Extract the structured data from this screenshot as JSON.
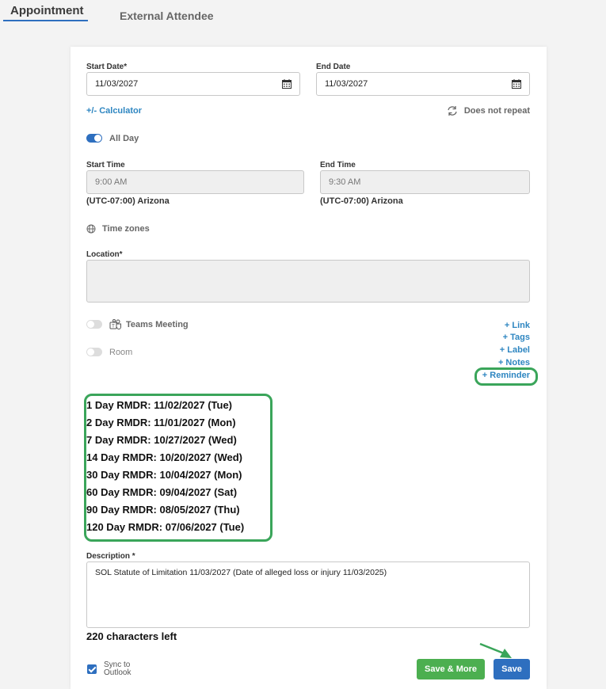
{
  "tabs": [
    {
      "label": "Appointment",
      "active": true
    },
    {
      "label": "External Attendee",
      "active": false
    }
  ],
  "form": {
    "start_date_label": "Start Date*",
    "start_date_value": "11/03/2027",
    "end_date_label": "End Date",
    "end_date_value": "11/03/2027",
    "calculator_link": "+/- Calculator",
    "repeat_label": "Does not repeat",
    "all_day_label": "All Day",
    "start_time_label": "Start Time",
    "start_time_value": "9:00 AM",
    "end_time_label": "End Time",
    "end_time_value": "9:30 AM",
    "start_timezone": "(UTC-07:00) Arizona",
    "end_timezone": "(UTC-07:00) Arizona",
    "time_zones_link": "Time zones",
    "location_label": "Location*",
    "teams_meeting_label": "Teams Meeting",
    "room_label": "Room",
    "links": {
      "link": "+ Link",
      "tags": "+ Tags",
      "label": "+ Label",
      "notes": "+ Notes",
      "reminder": "+ Reminder"
    },
    "reminders": [
      "1 Day RMDR: 11/02/2027 (Tue)",
      "2 Day RMDR: 11/01/2027 (Mon)",
      "7 Day RMDR: 10/27/2027 (Wed)",
      "14 Day RMDR: 10/20/2027 (Wed)",
      "30 Day RMDR: 10/04/2027 (Mon)",
      "60 Day RMDR: 09/04/2027 (Sat)",
      "90 Day RMDR: 08/05/2027 (Thu)",
      "120 Day RMDR: 07/06/2027 (Tue)"
    ],
    "description_label": "Description *",
    "description_value": "SOL Statute of Limitation 11/03/2027 (Date of alleged loss or injury 11/03/2025)",
    "chars_left": "220 characters left",
    "sync_label_line1": "Sync to",
    "sync_label_line2": "Outlook",
    "save_more_button": "Save & More",
    "save_button": "Save"
  },
  "colors": {
    "accent": "#2e6fbf",
    "link": "#2e86c1",
    "highlight": "#3aa55a",
    "save_more": "#4caf50"
  }
}
